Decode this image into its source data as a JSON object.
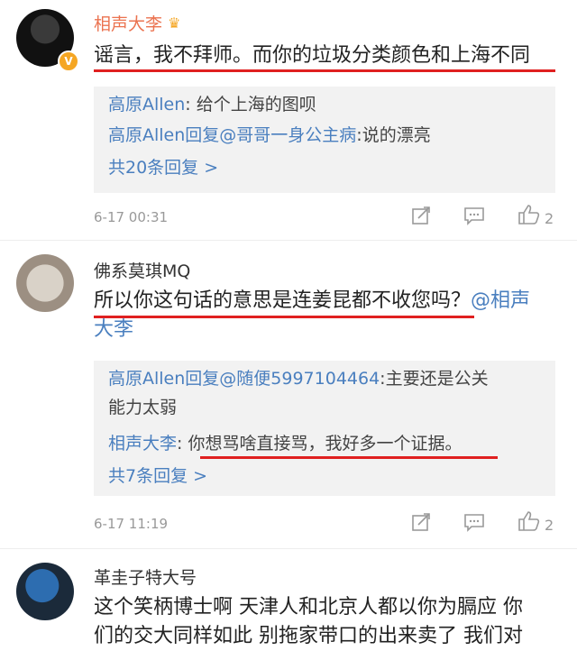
{
  "comments": [
    {
      "username": "相声大李",
      "text": "谣言，我不拜师。而你的垃圾分类颜色和上海不同",
      "replies": [
        {
          "name": "高原Allen",
          "sep": ": ",
          "content": "给个上海的图呗"
        },
        {
          "name": "高原Allen回复@哥哥一身公主病",
          "sep": ":",
          "content": "说的漂亮"
        }
      ],
      "more": "共20条回复 >",
      "time": "6-17 00:31",
      "likes": "2"
    },
    {
      "username": "佛系莫琪MQ",
      "text_line1": "所以你这句话的意思是连姜昆都不收您吗？",
      "mention": "@相声",
      "text_line2": "大李",
      "replies": [
        {
          "name": "高原Allen回复@随便5997104464",
          "sep": ":",
          "content": "主要还是公关",
          "content2": "能力太弱"
        },
        {
          "name": "相声大李",
          "sep": ": ",
          "content": "你想骂啥直接骂，我好多一个证据。"
        }
      ],
      "more": "共7条回复 >",
      "time": "6-17 11:19",
      "likes": "2"
    },
    {
      "username": "革圭子特大号",
      "text_line1": "这个笑柄博士啊 天津人和北京人都以你为膈应 你",
      "text_line2": "们的交大同样如此 别拖家带口的出来卖了 我们对"
    }
  ],
  "icons": {
    "verified": "verified-badge-icon",
    "crown": "vip-crown-icon",
    "share": "share-icon",
    "comment": "comment-icon",
    "like": "like-icon"
  },
  "colors": {
    "vip_name": "#eb7350",
    "link": "#4a7fbf",
    "underline": "#e02020"
  }
}
